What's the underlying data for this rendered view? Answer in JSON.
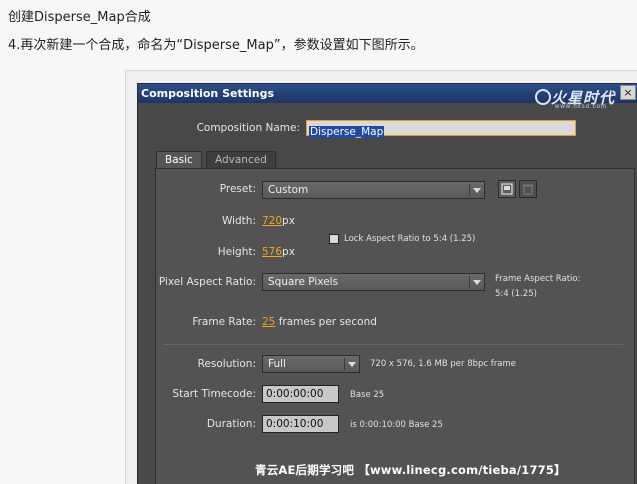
{
  "article": {
    "title": "创建Disperse_Map合成",
    "step": "4.再次新建一个合成，命名为“Disperse_Map”，参数设置如下图所示。"
  },
  "dialog": {
    "title": "Composition Settings",
    "close_label": "×",
    "logo_text": "火星时代",
    "logo_url": "www.hxsd.com",
    "composition_name_label": "Composition Name:",
    "composition_name_value": "Disperse_Map",
    "tabs": [
      {
        "label": "Basic",
        "active": true
      },
      {
        "label": "Advanced",
        "active": false
      }
    ],
    "preset_label": "Preset:",
    "preset_value": "Custom",
    "save_preset_icon": "save-preset-icon",
    "delete_preset_icon": "trash-icon",
    "width_label": "Width:",
    "width_value": "720",
    "width_unit": "px",
    "height_label": "Height:",
    "height_value": "576",
    "height_unit": "px",
    "lock_aspect_label": "Lock Aspect Ratio to 5:4 (1.25)",
    "lock_aspect_checked": false,
    "pixel_aspect_label": "Pixel Aspect Ratio:",
    "pixel_aspect_value": "Square Pixels",
    "frame_aspect_label": "Frame Aspect Ratio:",
    "frame_aspect_value": "5:4 (1.25)",
    "frame_rate_label": "Frame Rate:",
    "frame_rate_value": "25",
    "frame_rate_unit": "frames per second",
    "resolution_label": "Resolution:",
    "resolution_value": "Full",
    "resolution_info": "720 x 576, 1.6 MB per 8bpc frame",
    "start_timecode_label": "Start Timecode:",
    "start_timecode_value": "0:00:00:00",
    "start_timecode_base": "Base 25",
    "duration_label": "Duration:",
    "duration_value": "0:00:10:00",
    "duration_info": "is 0:00:10:00  Base 25"
  },
  "watermark": "青云AE后期学习吧 【www.linecg.com/tieba/1775】",
  "colors": {
    "title_bar": "#1c3566",
    "dialog_bg": "#484848",
    "value_accent": "#f0a521",
    "selection": "#1f4aa0"
  }
}
